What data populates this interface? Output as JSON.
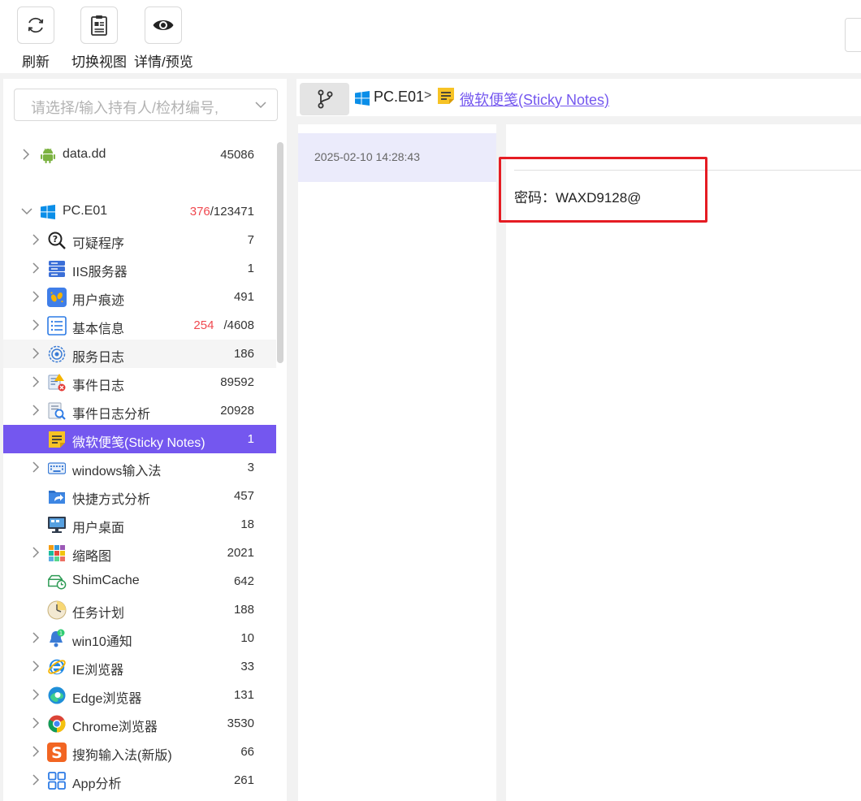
{
  "toolbar": {
    "refresh_label": "刷新",
    "switch_view_label": "切换视图",
    "detail_preview_label": "详情/预览"
  },
  "search": {
    "placeholder": "请选择/输入持有人/检材编号,"
  },
  "tree": [
    {
      "label": "data.dd",
      "count": "45086",
      "icon": "android-icon",
      "level": 0,
      "expandable": true,
      "state": "collapsed"
    },
    {
      "label": "PC.E01",
      "count_red": "376",
      "count": "/123471",
      "icon": "windows-icon",
      "level": 0,
      "expandable": true,
      "state": "expanded"
    },
    {
      "label": "可疑程序",
      "count": "7",
      "icon": "suspicious-search-icon",
      "level": 1,
      "expandable": true
    },
    {
      "label": "IIS服务器",
      "count": "1",
      "icon": "server-icon",
      "level": 1,
      "expandable": true
    },
    {
      "label": "用户痕迹",
      "count": "491",
      "icon": "footprint-icon",
      "level": 1,
      "expandable": true
    },
    {
      "label": "基本信息",
      "count_red": "254",
      "count": "/4608",
      "icon": "list-icon",
      "level": 1,
      "expandable": true
    },
    {
      "label": "服务日志",
      "count": "186",
      "icon": "service-log-icon",
      "level": 1,
      "expandable": true
    },
    {
      "label": "事件日志",
      "count": "89592",
      "icon": "event-log-icon",
      "level": 1,
      "expandable": true
    },
    {
      "label": "事件日志分析",
      "count": "20928",
      "icon": "event-analysis-icon",
      "level": 1,
      "expandable": true
    },
    {
      "label": "微软便笺(Sticky Notes)",
      "count": "1",
      "icon": "sticky-notes-icon",
      "level": 1,
      "expandable": false,
      "selected": true
    },
    {
      "label": "windows输入法",
      "count": "3",
      "icon": "keyboard-icon",
      "level": 1,
      "expandable": true
    },
    {
      "label": "快捷方式分析",
      "count": "457",
      "icon": "shortcut-icon",
      "level": 1,
      "expandable": false
    },
    {
      "label": "用户桌面",
      "count": "18",
      "icon": "desktop-icon",
      "level": 1,
      "expandable": false
    },
    {
      "label": "缩略图",
      "count": "2021",
      "icon": "thumbnail-icon",
      "level": 1,
      "expandable": true
    },
    {
      "label": "ShimCache",
      "count": "642",
      "icon": "shimcache-icon",
      "level": 1,
      "expandable": false
    },
    {
      "label": "任务计划",
      "count": "188",
      "icon": "clock-icon",
      "level": 1,
      "expandable": false
    },
    {
      "label": "win10通知",
      "count": "10",
      "icon": "bell-icon",
      "level": 1,
      "expandable": true
    },
    {
      "label": "IE浏览器",
      "count": "33",
      "icon": "ie-icon",
      "level": 1,
      "expandable": true
    },
    {
      "label": "Edge浏览器",
      "count": "131",
      "icon": "edge-icon",
      "level": 1,
      "expandable": true
    },
    {
      "label": "Chrome浏览器",
      "count": "3530",
      "icon": "chrome-icon",
      "level": 1,
      "expandable": true
    },
    {
      "label": "搜狗输入法(新版)",
      "count": "66",
      "icon": "sogou-icon",
      "level": 1,
      "expandable": true
    },
    {
      "label": "App分析",
      "count": "261",
      "icon": "apps-icon",
      "level": 1,
      "expandable": true
    }
  ],
  "breadcrumb": {
    "pc": "PC.E01",
    "separator": ">",
    "current": "微软便笺(Sticky Notes)"
  },
  "list": {
    "items": [
      {
        "timestamp": "2025-02-10 14:28:43"
      }
    ]
  },
  "detail": {
    "content": "密码：WAXD9128@"
  },
  "colors": {
    "accent": "#7457ef",
    "highlight_box": "#e51c23",
    "count_red": "#f0484f",
    "list_selected_bg": "#ebebfb"
  }
}
